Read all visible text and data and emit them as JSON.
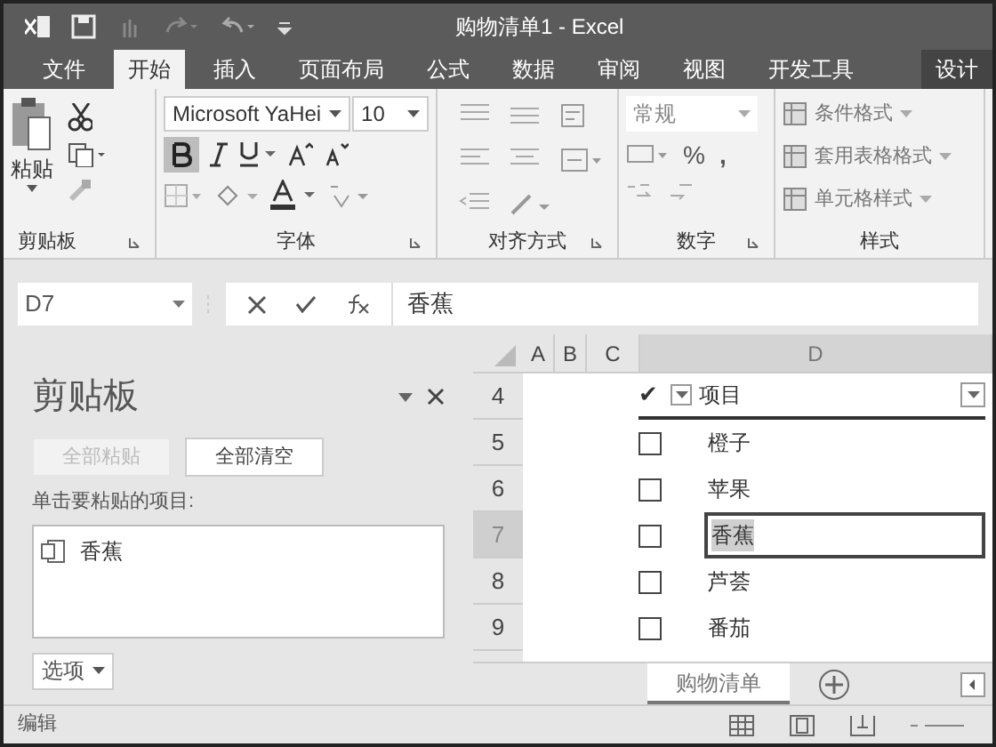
{
  "window": {
    "title": "购物清单1 - Excel"
  },
  "tabs": [
    {
      "label": "文件",
      "selected": false
    },
    {
      "label": "开始",
      "selected": true
    },
    {
      "label": "插入",
      "selected": false
    },
    {
      "label": "页面布局",
      "selected": false
    },
    {
      "label": "公式",
      "selected": false
    },
    {
      "label": "数据",
      "selected": false
    },
    {
      "label": "审阅",
      "selected": false
    },
    {
      "label": "视图",
      "selected": false
    },
    {
      "label": "开发工具",
      "selected": false
    },
    {
      "label": "设计",
      "selected": false
    }
  ],
  "ribbon": {
    "clipboard": {
      "paste": "粘贴",
      "label": "剪贴板"
    },
    "font": {
      "font_name": "Microsoft YaHei",
      "font_size": "10",
      "bold": true,
      "label": "字体"
    },
    "alignment": {
      "label": "对齐方式"
    },
    "number": {
      "format": "常规",
      "percent": "%",
      "comma": ",",
      "label": "数字"
    },
    "styles": {
      "items": [
        "条件格式",
        "套用表格格式",
        "单元格样式"
      ],
      "label": "样式"
    }
  },
  "formula_bar": {
    "name_box": "D7",
    "value": "香蕉"
  },
  "clipboard_pane": {
    "title": "剪贴板",
    "buttons": [
      {
        "label": "全部粘贴",
        "disabled": true
      },
      {
        "label": "全部清空",
        "disabled": false
      }
    ],
    "prompt": "单击要粘贴的项目:",
    "items": [
      "香蕉"
    ],
    "options": "选项"
  },
  "sheet": {
    "columns": [
      {
        "label": "A",
        "selected": false
      },
      {
        "label": "B",
        "selected": false
      },
      {
        "label": "C",
        "selected": false
      },
      {
        "label": "D",
        "selected": true
      }
    ],
    "header": {
      "check": "✔",
      "label": "项目"
    },
    "rows": [
      {
        "number": "4",
        "selected": false
      },
      {
        "number": "5",
        "selected": false
      },
      {
        "number": "6",
        "selected": false
      },
      {
        "number": "7",
        "selected": true
      },
      {
        "number": "8",
        "selected": false
      },
      {
        "number": "9",
        "selected": false
      }
    ],
    "items": [
      {
        "label": "橙子",
        "checked": false,
        "selected": false
      },
      {
        "label": "苹果",
        "checked": false,
        "selected": false
      },
      {
        "label": "香蕉",
        "checked": false,
        "selected": true
      },
      {
        "label": "芦荟",
        "checked": false,
        "selected": false
      },
      {
        "label": "番茄",
        "checked": false,
        "selected": false
      }
    ]
  },
  "sheet_tabs": [
    {
      "label": "购物清单",
      "selected": true
    }
  ],
  "status_bar": {
    "mode": "编辑"
  }
}
